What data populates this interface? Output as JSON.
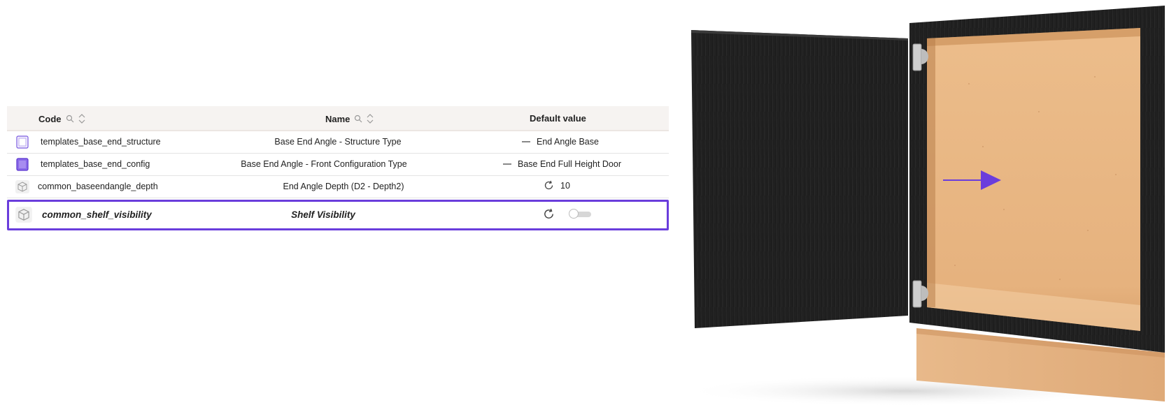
{
  "table": {
    "columns": {
      "code": "Code",
      "name": "Name",
      "default_value": "Default value"
    },
    "rows": [
      {
        "code": "templates_base_end_structure",
        "name": "Base End Angle - Structure Type",
        "default_value": "End Angle Base",
        "icon": "template-outline-icon",
        "default_icon": "dash-icon"
      },
      {
        "code": "templates_base_end_config",
        "name": "Base End Angle - Front Configuration Type",
        "default_value": "Base End Full Height Door",
        "icon": "template-filled-icon",
        "default_icon": "dash-icon"
      },
      {
        "code": "common_baseendangle_depth",
        "name": "End Angle Depth (D2 - Depth2)",
        "default_value": "10",
        "icon": "cube-icon",
        "default_icon": "refresh-icon"
      },
      {
        "code": "common_shelf_visibility",
        "name": "Shelf Visibility",
        "default_value": "off",
        "icon": "cube-icon",
        "default_icon": "refresh-icon",
        "highlighted": true
      }
    ]
  },
  "colors": {
    "accent": "#6a3ddc",
    "header_bg": "#f6f3f1",
    "door": "#1f1f1f",
    "panel": "#e8b784"
  }
}
